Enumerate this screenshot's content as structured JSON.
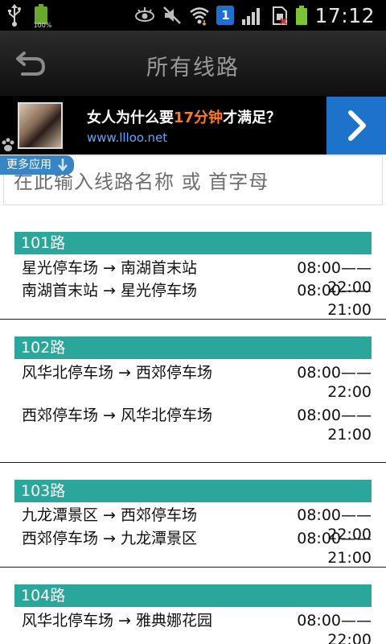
{
  "status_bar": {
    "battery_small_label": "100%",
    "time": "17:12",
    "notification_badge": "1"
  },
  "title_bar": {
    "title": "所有线路"
  },
  "ad": {
    "title_prefix": "女人为什么要",
    "title_highlight": "17分钟",
    "title_suffix": "才满足？",
    "url": "www.llloo.net",
    "more_apps_label": "更多应用"
  },
  "search": {
    "placeholder": "在此输入线路名称 或 首字母",
    "value": ""
  },
  "routes": [
    {
      "name": "101路",
      "directions": [
        {
          "path": "星光停车场 → 南湖首末站",
          "time": "08:00——22:00"
        },
        {
          "path": "南湖首末站 → 星光停车场",
          "time": "08:00——21:00"
        }
      ]
    },
    {
      "name": "102路",
      "directions": [
        {
          "path": "风华北停车场 → 西郊停车场",
          "time": "08:00——22:00"
        },
        {
          "path": "西郊停车场 → 风华北停车场",
          "time": "08:00——21:00"
        }
      ]
    },
    {
      "name": "103路",
      "directions": [
        {
          "path": "九龙潭景区 → 西郊停车场",
          "time": "08:00——22:00"
        },
        {
          "path": "西郊停车场 → 九龙潭景区",
          "time": "08:00——21:00"
        }
      ]
    },
    {
      "name": "104路",
      "directions": [
        {
          "path": "风华北停车场 → 雅典娜花园",
          "time": "08:00——22:00"
        }
      ]
    }
  ],
  "colors": {
    "route_header": "#2aa69b",
    "ad_arrow": "#1d73c9",
    "ad_highlight": "#ff7a1a",
    "ad_url": "#5fa8ff"
  },
  "icons": {
    "usb": "usb-icon",
    "battery": "battery-icon",
    "eye": "eye-icon",
    "mute": "mute-icon",
    "wifi": "wifi-icon",
    "signal": "signal-icon",
    "sim": "sim-icon",
    "back": "back-arrow-icon",
    "chevron": "chevron-right-icon",
    "download": "download-icon",
    "paw": "paw-icon"
  }
}
